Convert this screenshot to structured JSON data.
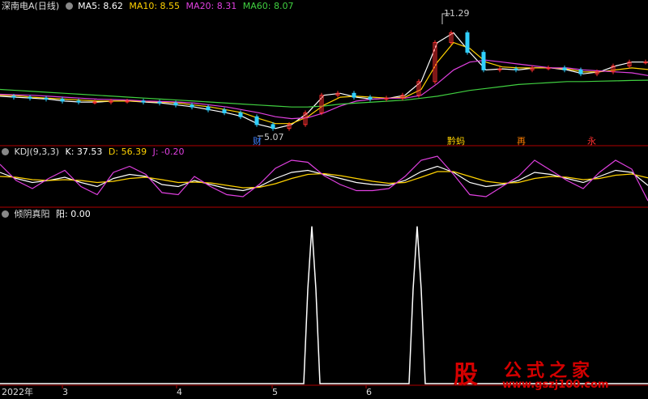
{
  "main_panel": {
    "title": "深南电A(日线)",
    "ma": [
      {
        "label": "MA5: 8.62",
        "color": "#ffffff"
      },
      {
        "label": "MA10: 8.55",
        "color": "#ffd200"
      },
      {
        "label": "MA20: 8.31",
        "color": "#e040e0"
      },
      {
        "label": "MA60: 8.07",
        "color": "#40d040"
      }
    ],
    "high_marker": "11.29",
    "low_marker": "5.07",
    "event_labels": [
      {
        "text": "财",
        "color": "#4080ff"
      },
      {
        "text": "黔蚂",
        "color": "#ffd200"
      },
      {
        "text": "再",
        "color": "#ff7f00"
      },
      {
        "text": "永",
        "color": "#ff3030"
      }
    ]
  },
  "kdj_panel": {
    "title": "KDJ(9,3,3)",
    "k": "K: 37.53",
    "d": "D: 56.39",
    "j": "J: -0.20",
    "k_color": "#ffffff",
    "d_color": "#ffd200",
    "j_color": "#e040e0"
  },
  "signal_panel": {
    "title": "倾阴真阳",
    "value": "阳: 0.00"
  },
  "x_axis": {
    "labels": [
      "2022年",
      "3",
      "4",
      "5",
      "6"
    ]
  },
  "watermark": {
    "logo": "股",
    "title": "公式之家",
    "url": "www.gszj100.com"
  },
  "chart_data": [
    {
      "type": "line",
      "name": "main-price-panel",
      "ylim": [
        4.8,
        11.6
      ],
      "x": [
        0,
        20,
        40,
        60,
        80,
        100,
        120,
        140,
        160,
        180,
        200,
        220,
        240,
        260,
        280,
        300,
        320,
        340,
        360,
        380,
        400,
        420,
        440,
        460,
        480,
        500,
        520,
        540,
        560,
        580,
        600,
        620,
        640,
        660,
        680,
        700,
        720,
        740,
        760,
        780,
        800
      ],
      "series": [
        {
          "name": "MA5",
          "values": [
            7.25,
            7.2,
            7.15,
            7.1,
            7.0,
            6.95,
            6.95,
            7.0,
            7.0,
            6.95,
            6.9,
            6.8,
            6.7,
            6.55,
            6.4,
            6.2,
            5.8,
            5.6,
            5.8,
            6.4,
            7.3,
            7.4,
            7.2,
            7.1,
            7.15,
            7.3,
            8.0,
            10.0,
            10.5,
            9.5,
            8.6,
            8.65,
            8.6,
            8.7,
            8.7,
            8.6,
            8.4,
            8.5,
            8.8,
            9.0,
            9.0
          ]
        },
        {
          "name": "MA10",
          "values": [
            7.3,
            7.28,
            7.2,
            7.15,
            7.1,
            7.05,
            7.0,
            7.0,
            7.0,
            6.98,
            6.95,
            6.9,
            6.8,
            6.7,
            6.55,
            6.4,
            6.1,
            5.85,
            5.85,
            6.2,
            6.8,
            7.2,
            7.25,
            7.2,
            7.15,
            7.2,
            7.6,
            9.0,
            10.0,
            9.7,
            9.0,
            8.75,
            8.7,
            8.7,
            8.7,
            8.65,
            8.5,
            8.5,
            8.6,
            8.7,
            8.62
          ]
        },
        {
          "name": "MA20",
          "values": [
            7.35,
            7.32,
            7.3,
            7.25,
            7.2,
            7.15,
            7.1,
            7.08,
            7.05,
            7.0,
            6.98,
            6.95,
            6.9,
            6.8,
            6.7,
            6.55,
            6.4,
            6.2,
            6.1,
            6.15,
            6.4,
            6.75,
            7.0,
            7.1,
            7.15,
            7.15,
            7.3,
            7.9,
            8.6,
            9.0,
            9.1,
            9.0,
            8.9,
            8.8,
            8.7,
            8.7,
            8.6,
            8.55,
            8.5,
            8.45,
            8.31
          ]
        },
        {
          "name": "MA60",
          "values": [
            7.6,
            7.55,
            7.5,
            7.45,
            7.4,
            7.35,
            7.3,
            7.25,
            7.2,
            7.15,
            7.1,
            7.05,
            7.0,
            6.95,
            6.9,
            6.85,
            6.8,
            6.75,
            6.7,
            6.7,
            6.75,
            6.85,
            6.9,
            6.95,
            7.0,
            7.05,
            7.15,
            7.25,
            7.4,
            7.55,
            7.65,
            7.75,
            7.85,
            7.9,
            7.95,
            8.0,
            8.0,
            8.02,
            8.04,
            8.06,
            8.07
          ]
        }
      ]
    },
    {
      "type": "line",
      "name": "kdj-panel",
      "ylim": [
        -10,
        110
      ],
      "x": [
        0,
        20,
        40,
        60,
        80,
        100,
        120,
        140,
        160,
        180,
        200,
        220,
        240,
        260,
        280,
        300,
        320,
        340,
        360,
        380,
        400,
        420,
        440,
        460,
        480,
        500,
        520,
        540,
        560,
        580,
        600,
        620,
        640,
        660,
        680,
        700,
        720,
        740,
        760,
        780,
        800
      ],
      "series": [
        {
          "name": "K",
          "values": [
            70,
            55,
            45,
            50,
            58,
            45,
            35,
            55,
            65,
            60,
            40,
            35,
            50,
            40,
            30,
            25,
            35,
            55,
            70,
            75,
            65,
            55,
            45,
            40,
            38,
            50,
            72,
            85,
            70,
            45,
            35,
            40,
            50,
            70,
            65,
            55,
            45,
            60,
            75,
            70,
            37.53
          ]
        },
        {
          "name": "D",
          "values": [
            60,
            58,
            52,
            50,
            52,
            50,
            45,
            48,
            55,
            58,
            52,
            45,
            46,
            44,
            38,
            32,
            33,
            42,
            55,
            65,
            67,
            62,
            55,
            48,
            43,
            45,
            58,
            72,
            72,
            60,
            48,
            43,
            45,
            55,
            60,
            58,
            52,
            55,
            63,
            66,
            56.39
          ]
        },
        {
          "name": "J",
          "values": [
            90,
            50,
            30,
            55,
            75,
            35,
            15,
            70,
            85,
            65,
            20,
            15,
            60,
            35,
            15,
            10,
            40,
            80,
            100,
            95,
            62,
            40,
            25,
            25,
            30,
            60,
            100,
            110,
            65,
            15,
            10,
            35,
            60,
            100,
            75,
            50,
            30,
            70,
            100,
            78,
            -0.2
          ]
        }
      ]
    },
    {
      "type": "line",
      "name": "signal-panel",
      "ylim": [
        0,
        1.05
      ],
      "x": [
        0,
        370,
        375,
        380,
        385,
        390,
        395,
        400,
        505,
        510,
        515,
        520,
        525,
        530,
        800
      ],
      "series": [
        {
          "name": "阳",
          "values": [
            0,
            0,
            0,
            0.6,
            1.0,
            0.6,
            0,
            0,
            0,
            0.6,
            1.0,
            0.6,
            0,
            0,
            0
          ]
        }
      ]
    }
  ]
}
